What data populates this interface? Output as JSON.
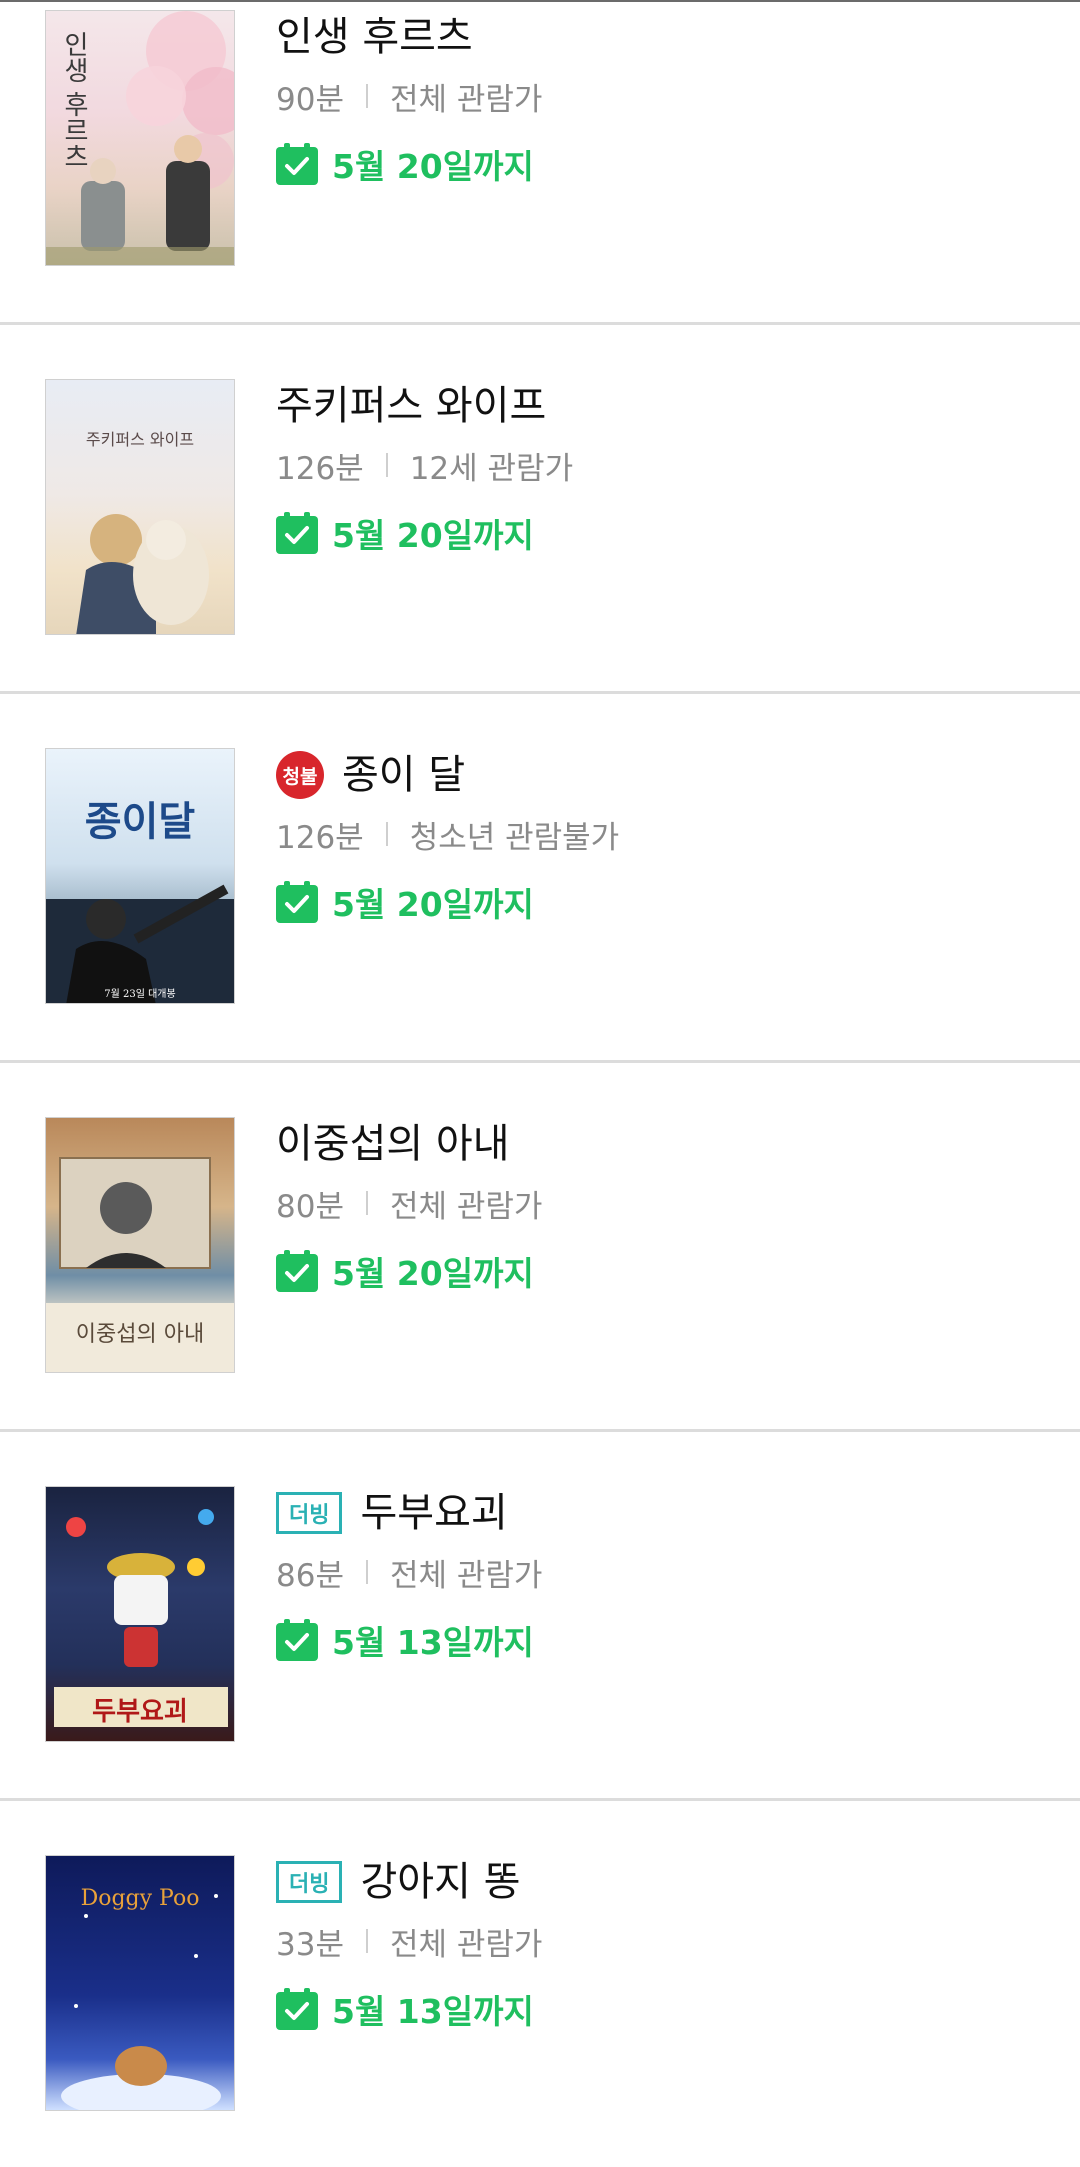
{
  "colors": {
    "accent_green": "#1fbf5f",
    "rating_red": "#d8262c",
    "dub_teal": "#2ab1b4",
    "divider": "#dcdcdc"
  },
  "movies": [
    {
      "title": "인생 후르츠",
      "runtime": "90분",
      "rating": "전체 관람가",
      "until": "5월 20일까지",
      "badge": null,
      "poster": {
        "text_main": "인생 후르츠",
        "icon": "cherry-blossom-poster"
      }
    },
    {
      "title": "주키퍼스 와이프",
      "runtime": "126분",
      "rating": "12세 관람가",
      "until": "5월 20일까지",
      "badge": null,
      "poster": {
        "text_main": "주키퍼스 와이프",
        "icon": "zookeeper-poster"
      }
    },
    {
      "title": "종이 달",
      "runtime": "126분",
      "rating": "청소년 관람불가",
      "until": "5월 20일까지",
      "badge": "청불",
      "poster": {
        "text_main": "종이달",
        "text_sub": "7월 23일 대개봉",
        "icon": "paper-moon-poster"
      }
    },
    {
      "title": "이중섭의 아내",
      "runtime": "80분",
      "rating": "전체 관람가",
      "until": "5월 20일까지",
      "badge": null,
      "poster": {
        "text_main": "이중섭의 아내",
        "icon": "lee-jungseob-poster"
      }
    },
    {
      "title": "두부요괴",
      "runtime": "86분",
      "rating": "전체 관람가",
      "until": "5월 13일까지",
      "badge": "더빙",
      "poster": {
        "text_main": "두부요괴",
        "icon": "tofu-monster-poster"
      }
    },
    {
      "title": "강아지 똥",
      "runtime": "33분",
      "rating": "전체 관람가",
      "until": "5월 13일까지",
      "badge": "더빙",
      "poster": {
        "text_main": "Doggy Poo",
        "icon": "doggy-poo-poster"
      }
    }
  ]
}
